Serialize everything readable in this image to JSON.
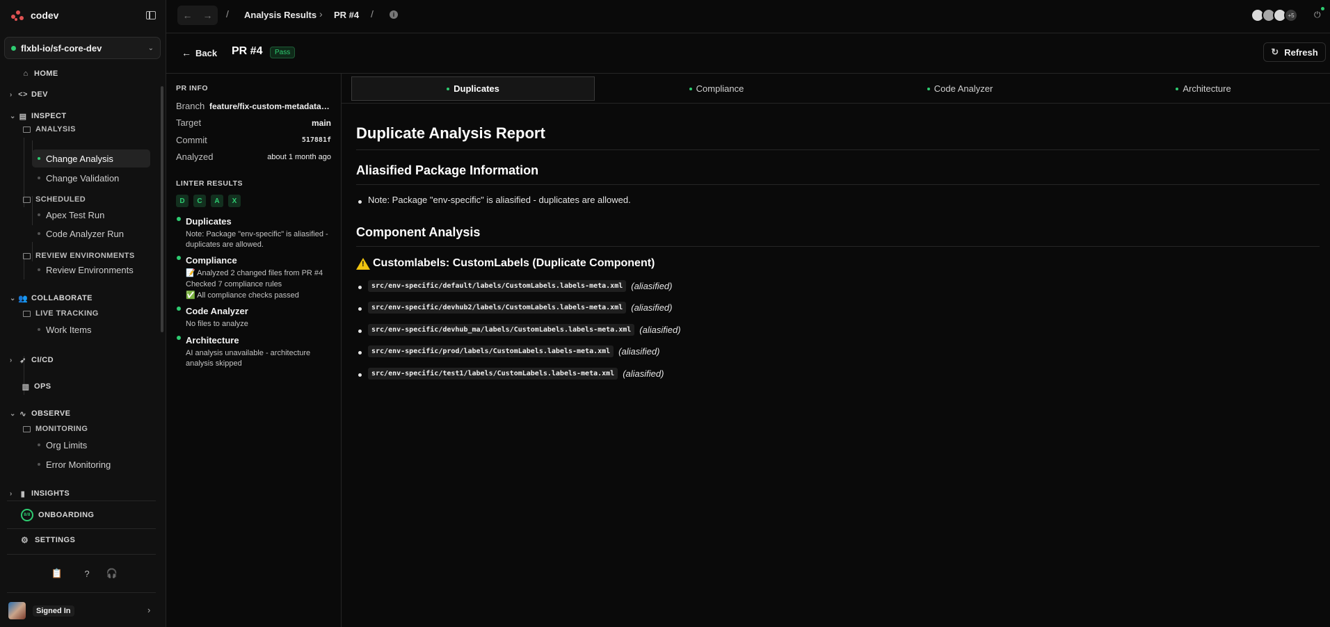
{
  "app": {
    "name": "codev",
    "org": "flxbl-io/sf-core-dev"
  },
  "sidebar": {
    "home": "HOME",
    "dev": "DEV",
    "inspect": "INSPECT",
    "analysis": "ANALYSIS",
    "change_analysis": "Change Analysis",
    "change_validation": "Change Validation",
    "scheduled": "SCHEDULED",
    "apex_test_run": "Apex Test Run",
    "code_analyzer_run": "Code Analyzer Run",
    "review_envs_group": "REVIEW ENVIRONMENTS",
    "review_envs": "Review Environments",
    "collaborate": "COLLABORATE",
    "live_tracking": "LIVE TRACKING",
    "work_items": "Work Items",
    "cicd": "CI/CD",
    "ops": "OPS",
    "observe": "OBSERVE",
    "monitoring": "MONITORING",
    "org_limits": "Org Limits",
    "error_monitoring": "Error Monitoring",
    "insights": "INSIGHTS",
    "onboarding": "ONBOARDING",
    "onboarding_progress": "8/8",
    "settings": "SETTINGS",
    "signed_in": "Signed In"
  },
  "topbar": {
    "crumb_1": "Analysis Results",
    "crumb_2": "PR #4",
    "sep": "/",
    "more_users": "+5"
  },
  "pr": {
    "back": "Back",
    "title": "PR #4",
    "status": "Pass",
    "refresh": "Refresh"
  },
  "pr_info": {
    "heading": "PR INFO",
    "branch_label": "Branch",
    "branch": "feature/fix-custom-metadata-aliasified",
    "target_label": "Target",
    "target": "main",
    "commit_label": "Commit",
    "commit": "517881f",
    "analyzed_label": "Analyzed",
    "analyzed": "about 1 month ago"
  },
  "linter": {
    "heading": "LINTER RESULTS",
    "chips": [
      "D",
      "C",
      "A",
      "X"
    ],
    "results": [
      {
        "title": "Duplicates",
        "desc": "Note: Package \"env-specific\" is aliasified - duplicates are allowed."
      },
      {
        "title": "Compliance",
        "desc_1": "📝 Analyzed 2 changed files from PR #4",
        "desc_2": "Checked 7 compliance rules",
        "desc_3": "✅ All compliance checks passed"
      },
      {
        "title": "Code Analyzer",
        "desc": "No files to analyze"
      },
      {
        "title": "Architecture",
        "desc": "AI analysis unavailable - architecture analysis skipped"
      }
    ]
  },
  "tabs": [
    "Duplicates",
    "Compliance",
    "Code Analyzer",
    "Architecture"
  ],
  "report": {
    "title": "Duplicate Analysis Report",
    "h2_a": "Aliasified Package Information",
    "note": "Note: Package \"env-specific\" is aliasified - duplicates are allowed.",
    "h2_b": "Component Analysis",
    "h3": "Customlabels: CustomLabels (Duplicate Component)",
    "tag": "(aliasified)",
    "files": [
      "src/env-specific/default/labels/CustomLabels.labels-meta.xml",
      "src/env-specific/devhub2/labels/CustomLabels.labels-meta.xml",
      "src/env-specific/devhub_ma/labels/CustomLabels.labels-meta.xml",
      "src/env-specific/prod/labels/CustomLabels.labels-meta.xml",
      "src/env-specific/test1/labels/CustomLabels.labels-meta.xml"
    ]
  }
}
